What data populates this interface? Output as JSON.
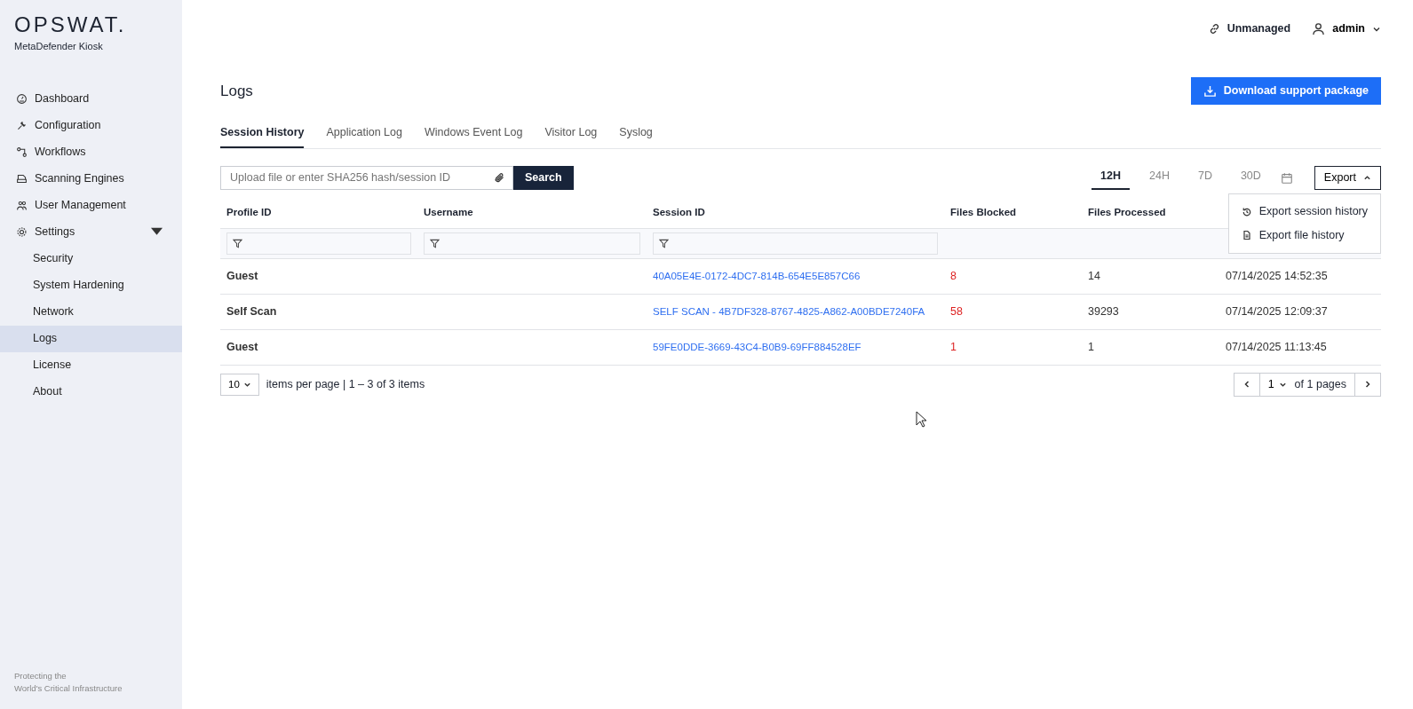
{
  "brand": {
    "logo": "OPSWAT.",
    "product": "MetaDefender Kiosk"
  },
  "sidebar": {
    "items": [
      {
        "label": "Dashboard",
        "selected": false
      },
      {
        "label": "Configuration",
        "selected": false
      },
      {
        "label": "Workflows",
        "selected": false
      },
      {
        "label": "Scanning Engines",
        "selected": false
      },
      {
        "label": "User Management",
        "selected": false
      },
      {
        "label": "Settings",
        "selected": false,
        "expanded": true,
        "children": [
          {
            "label": "Security",
            "selected": false
          },
          {
            "label": "System Hardening",
            "selected": false
          },
          {
            "label": "Network",
            "selected": false
          },
          {
            "label": "Logs",
            "selected": true
          },
          {
            "label": "License",
            "selected": false
          },
          {
            "label": "About",
            "selected": false
          }
        ]
      }
    ],
    "footer": [
      "Protecting the",
      "World's Critical Infrastructure"
    ]
  },
  "header": {
    "status": "Unmanaged",
    "user": "admin"
  },
  "page": {
    "title": "Logs",
    "action": "Download support package"
  },
  "tabs": [
    {
      "label": "Session History",
      "selected": true
    },
    {
      "label": "Application Log",
      "selected": false
    },
    {
      "label": "Windows Event Log",
      "selected": false
    },
    {
      "label": "Visitor Log",
      "selected": false
    },
    {
      "label": "Syslog",
      "selected": false
    }
  ],
  "search": {
    "placeholder": "Upload file or enter SHA256 hash/session ID",
    "button": "Search"
  },
  "ranges": [
    {
      "label": "12H",
      "selected": true
    },
    {
      "label": "24H",
      "selected": false
    },
    {
      "label": "7D",
      "selected": false
    },
    {
      "label": "30D",
      "selected": false
    }
  ],
  "export": {
    "label": "Export",
    "expanded": true,
    "items": [
      "Export session history",
      "Export file history"
    ]
  },
  "table": {
    "columns": [
      {
        "label": "Profile ID",
        "filter": true
      },
      {
        "label": "Username",
        "filter": true
      },
      {
        "label": "Session ID",
        "filter": true
      },
      {
        "label": "Files Blocked",
        "filter": false
      },
      {
        "label": "Files Processed",
        "filter": false
      }
    ],
    "rows": [
      [
        "Guest",
        "",
        "40A05E4E-0172-4DC7-814B-654E5E857C66",
        "8",
        "14",
        "07/14/2025 14:52:35"
      ],
      [
        "Self Scan",
        "",
        "SELF SCAN - 4B7DF328-8767-4825-A862-A00BDE7240FA",
        "58",
        "39293",
        "07/14/2025 12:09:37"
      ],
      [
        "Guest",
        "",
        "59FE0DDE-3669-43C4-B0B9-69FF884528EF",
        "1",
        "1",
        "07/14/2025 11:13:45"
      ]
    ]
  },
  "pagination": {
    "page_size": "10",
    "summary": "items per page | 1 – 3 of 3 items",
    "page": "1",
    "of_pages": "of 1 pages"
  }
}
